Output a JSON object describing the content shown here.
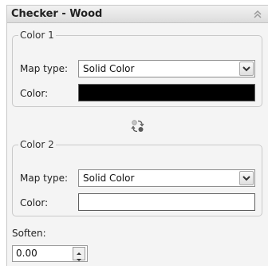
{
  "panel": {
    "title": "Checker - Wood"
  },
  "color1": {
    "group_label": "Color 1",
    "map_type_label": "Map type:",
    "map_type_value": "Solid Color",
    "color_label": "Color:",
    "swatch_color": "#000000"
  },
  "color2": {
    "group_label": "Color 2",
    "map_type_label": "Map type:",
    "map_type_value": "Solid Color",
    "color_label": "Color:",
    "swatch_color": "#ffffff"
  },
  "soften": {
    "label": "Soften:",
    "value": "0.00"
  },
  "icons": {
    "collapse": "chevron-double-up-icon",
    "swap": "swap-colors-icon",
    "dropdown": "chevron-down-icon",
    "spin_up": "arrow-up-icon",
    "spin_down": "arrow-down-icon"
  }
}
